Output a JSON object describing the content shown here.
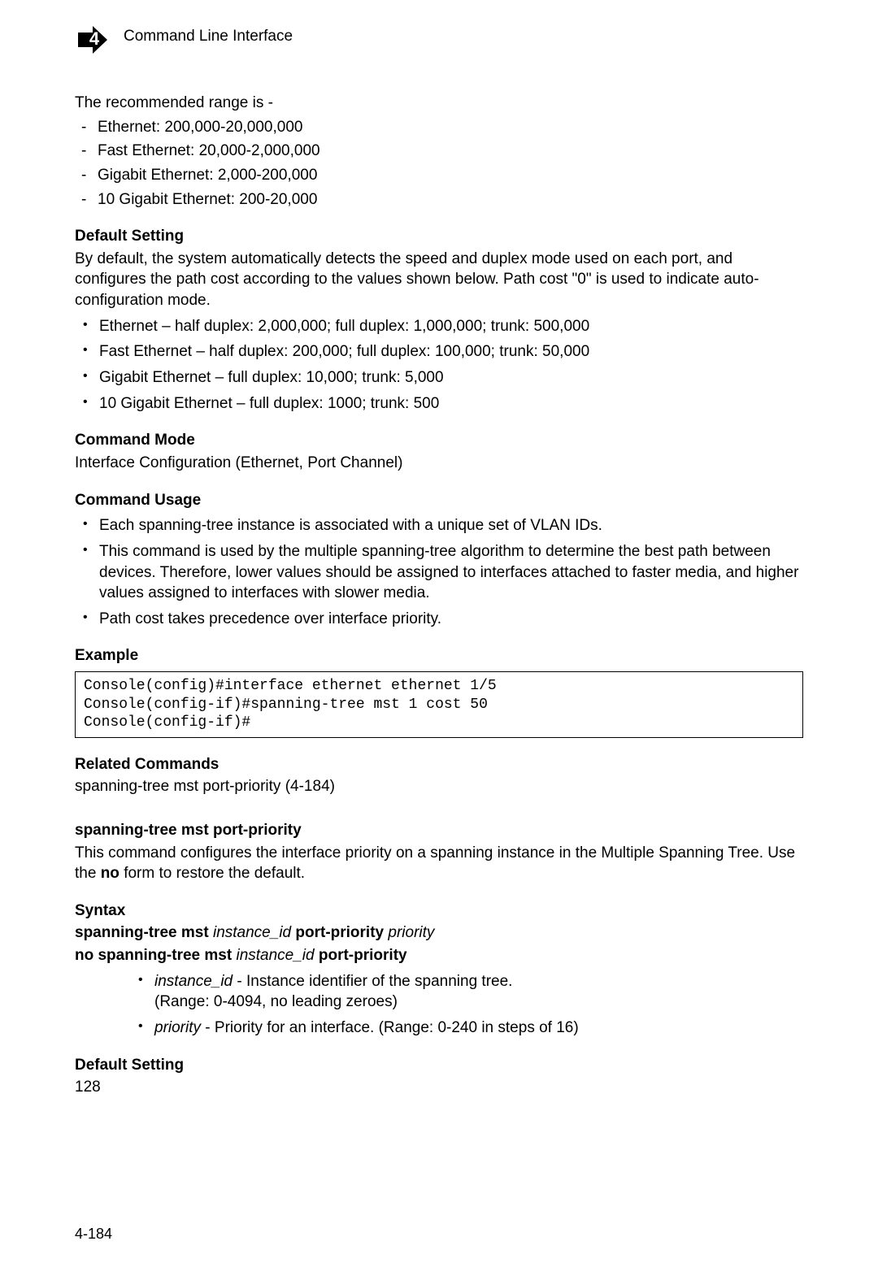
{
  "header": {
    "chapter_number": "4",
    "chapter_title": "Command Line Interface"
  },
  "recommended_range_intro": "The recommended range is -",
  "recommended_ranges": [
    "Ethernet: 200,000-20,000,000",
    "Fast Ethernet: 20,000-2,000,000",
    "Gigabit Ethernet: 2,000-200,000",
    "10 Gigabit Ethernet: 200-20,000"
  ],
  "default_setting": {
    "heading": "Default Setting",
    "body": "By default, the system automatically detects the speed and duplex mode used on each port, and configures the path cost according to the values shown below. Path cost \"0\" is used to indicate auto-configuration mode.",
    "items": [
      "Ethernet – half duplex: 2,000,000; full duplex: 1,000,000; trunk: 500,000",
      "Fast Ethernet – half duplex: 200,000; full duplex: 100,000; trunk: 50,000",
      "Gigabit Ethernet – full duplex: 10,000; trunk: 5,000",
      "10 Gigabit Ethernet – full duplex: 1000; trunk: 500"
    ]
  },
  "command_mode": {
    "heading": "Command Mode",
    "body": "Interface Configuration (Ethernet, Port Channel)"
  },
  "command_usage": {
    "heading": "Command Usage",
    "items": [
      "Each spanning-tree instance is associated with a unique set of VLAN IDs.",
      "This command is used by the multiple spanning-tree algorithm to determine the best path between devices. Therefore, lower values should be assigned to interfaces attached to faster media, and higher values assigned to interfaces with slower media.",
      "Path cost takes precedence over interface priority."
    ]
  },
  "example": {
    "heading": "Example",
    "code": "Console(config)#interface ethernet ethernet 1/5\nConsole(config-if)#spanning-tree mst 1 cost 50\nConsole(config-if)#"
  },
  "related_commands": {
    "heading": "Related Commands",
    "body": "spanning-tree mst port-priority (4-184)"
  },
  "new_cmd": {
    "name_heading": "spanning-tree mst port-priority",
    "description_pre": "This command configures the interface priority on a spanning instance in the Multiple Spanning Tree. Use the ",
    "description_bold": "no",
    "description_post": " form to restore the default.",
    "syntax_heading": "Syntax",
    "syntax_lines": {
      "l1_b1": "spanning-tree mst ",
      "l1_i1": "instance_id",
      "l1_b2": " port-priority ",
      "l1_i2": "priority",
      "l2_b1": "no spanning-tree mst ",
      "l2_i1": "instance_id",
      "l2_b2": " port-priority"
    },
    "params": [
      {
        "name": "instance_id",
        "desc": " - Instance identifier of the spanning tree.",
        "note": "(Range: 0-4094, no leading zeroes)"
      },
      {
        "name": "priority",
        "desc": " - Priority for an interface. (Range: 0-240 in steps of 16)",
        "note": ""
      }
    ],
    "default_setting_heading": "Default Setting",
    "default_setting_value": "128"
  },
  "footer": {
    "page_number": "4-184"
  }
}
